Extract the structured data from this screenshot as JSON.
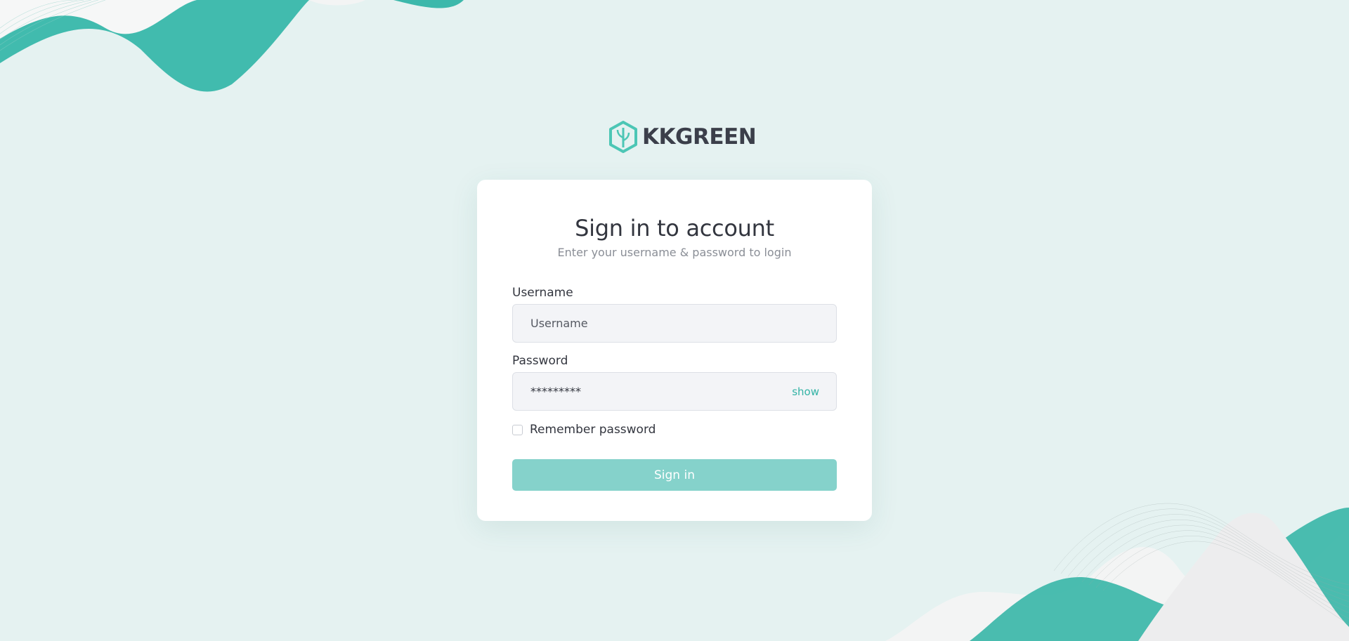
{
  "brand": {
    "name": "KKGREEN",
    "accent_color": "#3ec1b2"
  },
  "card": {
    "title": "Sign in to account",
    "subtitle": "Enter your username & password to login"
  },
  "form": {
    "username": {
      "label": "Username",
      "placeholder": "Username",
      "value": ""
    },
    "password": {
      "label": "Password",
      "value": "*********",
      "toggle_label": "show"
    },
    "remember": {
      "label": "Remember password",
      "checked": false
    },
    "submit_label": "Sign in",
    "submit_color": "#85d2cb"
  }
}
